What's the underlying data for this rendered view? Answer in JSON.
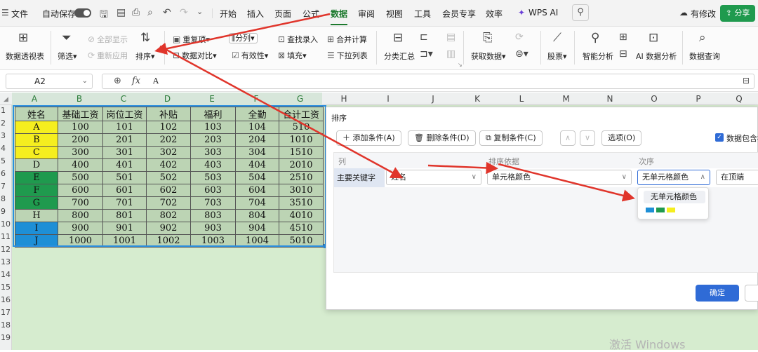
{
  "menubar": {
    "app_menu": "文件",
    "autosave_label": "自动保存",
    "tabs": [
      "开始",
      "插入",
      "页面",
      "公式",
      "数据",
      "审阅",
      "视图",
      "工具",
      "会员专享",
      "效率"
    ],
    "active_tab": "数据",
    "wps_ai": "WPS AI",
    "modified": "有修改",
    "share": "分享"
  },
  "ribbon": {
    "pivot": "数据透视表",
    "filter": "筛选",
    "show_all": "全部显示",
    "reapply": "重新应用",
    "sort": "排序",
    "duplicates": "重复项",
    "data_compare": "数据对比",
    "split_column": "分列",
    "validity": "有效性",
    "find_entry": "查找录入",
    "fill": "填充",
    "consolidate": "合并计算",
    "dropdown_list": "下拉列表",
    "subtotal": "分类汇总",
    "get_data": "获取数据",
    "stocks": "股票",
    "smart_analysis": "智能分析",
    "ai_analysis": "AI 数据分析",
    "data_query": "数据查询"
  },
  "formula_bar": {
    "cell_ref": "A2",
    "fx": "fx",
    "content": "A"
  },
  "columns": [
    "A",
    "B",
    "C",
    "D",
    "E",
    "F",
    "G",
    "H",
    "I",
    "J",
    "K",
    "L",
    "M",
    "N",
    "O",
    "P",
    "Q"
  ],
  "rows": [
    "1",
    "2",
    "3",
    "4",
    "5",
    "6",
    "7",
    "8",
    "9",
    "10",
    "11",
    "12",
    "13",
    "14",
    "15",
    "16",
    "17",
    "18",
    "19"
  ],
  "table": {
    "headers": [
      "姓名",
      "基础工资",
      "岗位工资",
      "补贴",
      "福利",
      "全勤",
      "合计工资"
    ],
    "rows": [
      [
        "A",
        "100",
        "101",
        "102",
        "103",
        "104",
        "510"
      ],
      [
        "B",
        "200",
        "201",
        "202",
        "203",
        "204",
        "1010"
      ],
      [
        "C",
        "300",
        "301",
        "302",
        "303",
        "304",
        "1510"
      ],
      [
        "D",
        "400",
        "401",
        "402",
        "403",
        "404",
        "2010"
      ],
      [
        "E",
        "500",
        "501",
        "502",
        "503",
        "504",
        "2510"
      ],
      [
        "F",
        "600",
        "601",
        "602",
        "603",
        "604",
        "3010"
      ],
      [
        "G",
        "700",
        "701",
        "702",
        "703",
        "704",
        "3510"
      ],
      [
        "H",
        "800",
        "801",
        "802",
        "803",
        "804",
        "4010"
      ],
      [
        "I",
        "900",
        "901",
        "902",
        "903",
        "904",
        "4510"
      ],
      [
        "J",
        "1000",
        "1001",
        "1002",
        "1003",
        "1004",
        "5010"
      ]
    ],
    "name_cell_colors": [
      "#f5ee1f",
      "#f5ee1f",
      "#f5ee1f",
      "#bcd4b4",
      "#1f9a4e",
      "#1f9a4e",
      "#1f9a4e",
      "#bcd4b4",
      "#1e8fd6",
      "#1e8fd6"
    ],
    "selection_color": "#2b8fe0"
  },
  "dialog": {
    "title": "排序",
    "add_condition": "添加条件(A)",
    "delete_condition": "删除条件(D)",
    "copy_condition": "复制条件(C)",
    "options": "选项(O)",
    "has_header": "数据包含标",
    "col_header": "列",
    "basis_header": "排序依据",
    "order_header": "次序",
    "primary_key": "主要关键字",
    "column_value": "姓名",
    "basis_value": "单元格颜色",
    "order_value": "无单元格颜色",
    "position_value": "在顶端",
    "ok": "确定"
  },
  "popup": {
    "option": "无单元格颜色",
    "swatches": [
      "#1e8fd6",
      "#1f9a4e",
      "#f5ee1f"
    ]
  },
  "watermark": "激活 Windows",
  "annotation_color": "#e0352b"
}
